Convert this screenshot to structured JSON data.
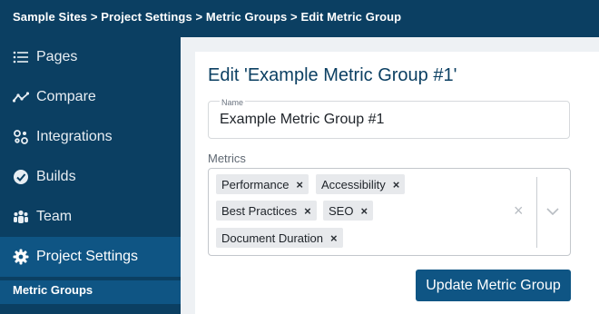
{
  "breadcrumb": "Sample Sites > Project Settings > Metric Groups > Edit Metric Group",
  "sidebar": {
    "items": [
      {
        "label": "Pages",
        "icon": "list-icon"
      },
      {
        "label": "Compare",
        "icon": "trend-icon"
      },
      {
        "label": "Integrations",
        "icon": "integrations-icon"
      },
      {
        "label": "Builds",
        "icon": "check-circle-icon"
      },
      {
        "label": "Team",
        "icon": "team-icon"
      },
      {
        "label": "Project Settings",
        "icon": "gear-icon",
        "active": true
      }
    ],
    "sub_item": "Metric Groups"
  },
  "form": {
    "title": "Edit 'Example Metric Group #1'",
    "name_legend": "Name",
    "name_value": "Example Metric Group #1",
    "metrics_label": "Metrics",
    "metrics": [
      "Performance",
      "Accessibility",
      "Best Practices",
      "SEO",
      "Document Duration"
    ],
    "chip_remove": "×",
    "clear_all": "×",
    "submit_label": "Update Metric Group"
  },
  "colors": {
    "nav_bg": "#0b3f62",
    "active_bg": "#0f5584",
    "button_bg": "#0f5584",
    "content_bg": "#eef1f4"
  }
}
